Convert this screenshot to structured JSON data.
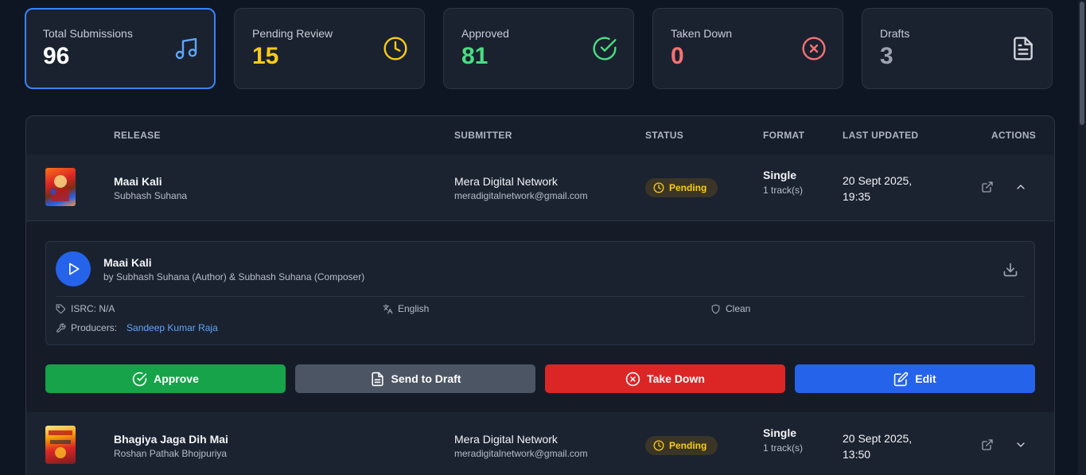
{
  "stats": [
    {
      "label": "Total Submissions",
      "value": "96",
      "color": "#ffffff",
      "icon": "music-note-icon",
      "icon_color": "#60a5fa"
    },
    {
      "label": "Pending Review",
      "value": "15",
      "color": "#facc15",
      "icon": "clock-icon",
      "icon_color": "#facc15"
    },
    {
      "label": "Approved",
      "value": "81",
      "color": "#4ade80",
      "icon": "check-circle-icon",
      "icon_color": "#4ade80"
    },
    {
      "label": "Taken Down",
      "value": "0",
      "color": "#f87171",
      "icon": "x-circle-icon",
      "icon_color": "#f87171"
    },
    {
      "label": "Drafts",
      "value": "3",
      "color": "#9ca3af",
      "icon": "document-icon",
      "icon_color": "#d1d5db"
    }
  ],
  "table": {
    "headers": {
      "release": "RELEASE",
      "submitter": "SUBMITTER",
      "status": "STATUS",
      "format": "FORMAT",
      "last_updated": "LAST UPDATED",
      "actions": "ACTIONS"
    },
    "rows": [
      {
        "title": "Maai Kali",
        "artist": "Subhash Suhana",
        "submitter_name": "Mera Digital Network",
        "submitter_email": "meradigitalnetwork@gmail.com",
        "status": "Pending",
        "format": "Single",
        "tracks": "1 track(s)",
        "updated": "20 Sept 2025, 19:35",
        "expanded": true
      },
      {
        "title": "Bhagiya Jaga Dih Mai",
        "artist": "Roshan Pathak Bhojpuriya",
        "submitter_name": "Mera Digital Network",
        "submitter_email": "meradigitalnetwork@gmail.com",
        "status": "Pending",
        "format": "Single",
        "tracks": "1 track(s)",
        "updated": "20 Sept 2025, 13:50",
        "expanded": false
      }
    ]
  },
  "detail": {
    "track_title": "Maai Kali",
    "track_by": "by Subhash Suhana (Author) & Subhash Suhana (Composer)",
    "isrc": "ISRC: N/A",
    "language": "English",
    "explicit": "Clean",
    "producers_label": "Producers:",
    "producers": "Sandeep Kumar Raja"
  },
  "actions": {
    "approve": "Approve",
    "send_to_draft": "Send to Draft",
    "take_down": "Take Down",
    "edit": "Edit"
  }
}
